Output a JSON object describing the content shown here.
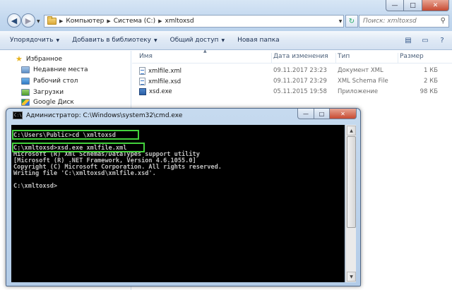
{
  "explorer": {
    "breadcrumbs": [
      "Компьютер",
      "Система (C:)",
      "xmltoxsd"
    ],
    "search_placeholder": "Поиск: xmltoxsd",
    "toolbar": {
      "organize": "Упорядочить",
      "add_to_library": "Добавить в библиотеку",
      "share": "Общий доступ",
      "new_folder": "Новая папка"
    },
    "sidebar": {
      "favorites": "Избранное",
      "items": [
        {
          "label": "Недавние места",
          "icon": "recent-places-icon"
        },
        {
          "label": "Рабочий стол",
          "icon": "desktop-icon"
        },
        {
          "label": "Загрузки",
          "icon": "downloads-icon"
        },
        {
          "label": "Google Диск",
          "icon": "google-drive-icon"
        }
      ]
    },
    "columns": {
      "name": "Имя",
      "date": "Дата изменения",
      "type": "Тип",
      "size": "Размер"
    },
    "files": [
      {
        "name": "xmlfile.xml",
        "date": "09.11.2017 23:23",
        "type": "Документ XML",
        "size": "1 КБ",
        "icon": "xml-file-icon"
      },
      {
        "name": "xmlfile.xsd",
        "date": "09.11.2017 23:29",
        "type": "XML Schema File",
        "size": "2 КБ",
        "icon": "xsd-file-icon"
      },
      {
        "name": "xsd.exe",
        "date": "05.11.2015 19:58",
        "type": "Приложение",
        "size": "98 КБ",
        "icon": "exe-file-icon"
      }
    ]
  },
  "cmd": {
    "title": "Администратор: C:\\Windows\\system32\\cmd.exe",
    "lines": [
      "C:\\Users\\Public>cd \\xmltoxsd",
      "",
      "C:\\xmltoxsd>xsd.exe xmlfile.xml",
      "Microsoft (R) Xml Schemas/DataTypes support utility",
      "[Microsoft (R) .NET Framework, Version 4.6.1055.0]",
      "Copyright (C) Microsoft Corporation. All rights reserved.",
      "Writing file 'C:\\xmltoxsd\\xmlfile.xsd'.",
      "",
      "C:\\xmltoxsd>"
    ],
    "highlight_color": "#43d23c"
  }
}
